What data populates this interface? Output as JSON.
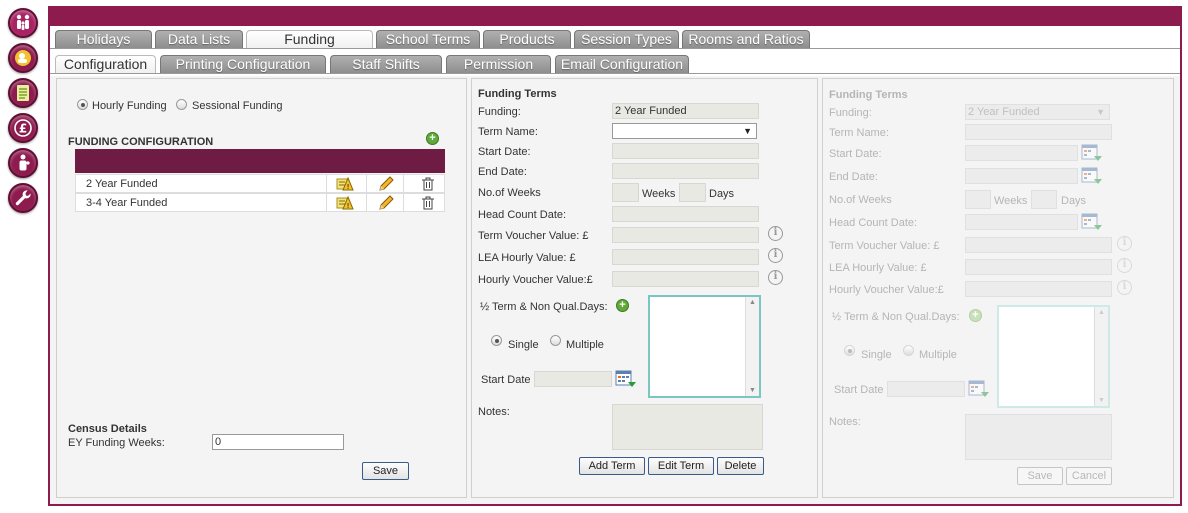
{
  "tabs_row1": [
    {
      "label": "Holidays"
    },
    {
      "label": "Data Lists"
    },
    {
      "label": "Funding"
    },
    {
      "label": "School Terms"
    },
    {
      "label": "Products"
    },
    {
      "label": "Session Types"
    },
    {
      "label": "Rooms and Ratios"
    }
  ],
  "tabs_row2": [
    {
      "label": "Configuration"
    },
    {
      "label": "Printing Configuration"
    },
    {
      "label": "Staff Shifts"
    },
    {
      "label": "Permission"
    },
    {
      "label": "Email Configuration"
    }
  ],
  "left": {
    "radio_hourly": "Hourly Funding",
    "radio_sessional": "Sessional Funding",
    "section_title": "FUNDING CONFIGURATION",
    "rows": [
      {
        "name": "2 Year Funded"
      },
      {
        "name": "3-4 Year Funded"
      }
    ],
    "census_title": "Census Details",
    "ey_label": "EY Funding Weeks:",
    "ey_value": "0",
    "save_label": "Save"
  },
  "middle": {
    "title": "Funding Terms",
    "funding_label": "Funding:",
    "funding_value": "2 Year Funded",
    "term_name_label": "Term Name:",
    "start_date_label": "Start Date:",
    "end_date_label": "End Date:",
    "weeks_label": "No.of Weeks",
    "weeks_unit": "Weeks",
    "days_unit": "Days",
    "head_count_label": "Head Count Date:",
    "term_voucher_label": "Term Voucher Value: £",
    "lea_hourly_label": "LEA Hourly Value: £",
    "hourly_voucher_label": "Hourly Voucher Value:£",
    "half_term_label": "½ Term & Non Qual.Days:",
    "single_label": "Single",
    "multiple_label": "Multiple",
    "start_date2_label": "Start Date",
    "notes_label": "Notes:",
    "add_term": "Add Term",
    "edit_term": "Edit Term",
    "delete": "Delete"
  },
  "right": {
    "title": "Funding Terms",
    "funding_label": "Funding:",
    "funding_value": "2 Year Funded",
    "term_name_label": "Term Name:",
    "start_date_label": "Start Date:",
    "end_date_label": "End Date:",
    "weeks_label": "No.of Weeks",
    "weeks_unit": "Weeks",
    "days_unit": "Days",
    "head_count_label": "Head Count Date:",
    "term_voucher_label": "Term Voucher Value: £",
    "lea_hourly_label": "LEA Hourly Value: £",
    "hourly_voucher_label": "Hourly Voucher Value:£",
    "half_term_label": "½ Term & Non Qual.Days:",
    "single_label": "Single",
    "multiple_label": "Multiple",
    "start_date2_label": "Start Date",
    "notes_label": "Notes:",
    "save_label": "Save",
    "cancel_label": "Cancel"
  },
  "icons": {
    "info": "i",
    "plus": "+",
    "select_arrow": "▼",
    "scroll_up": "▲",
    "scroll_down": "▼"
  },
  "colors": {
    "brand": "#8d1b4e",
    "table_header": "#6e1c44",
    "textarea_border": "#7cc6c2"
  }
}
